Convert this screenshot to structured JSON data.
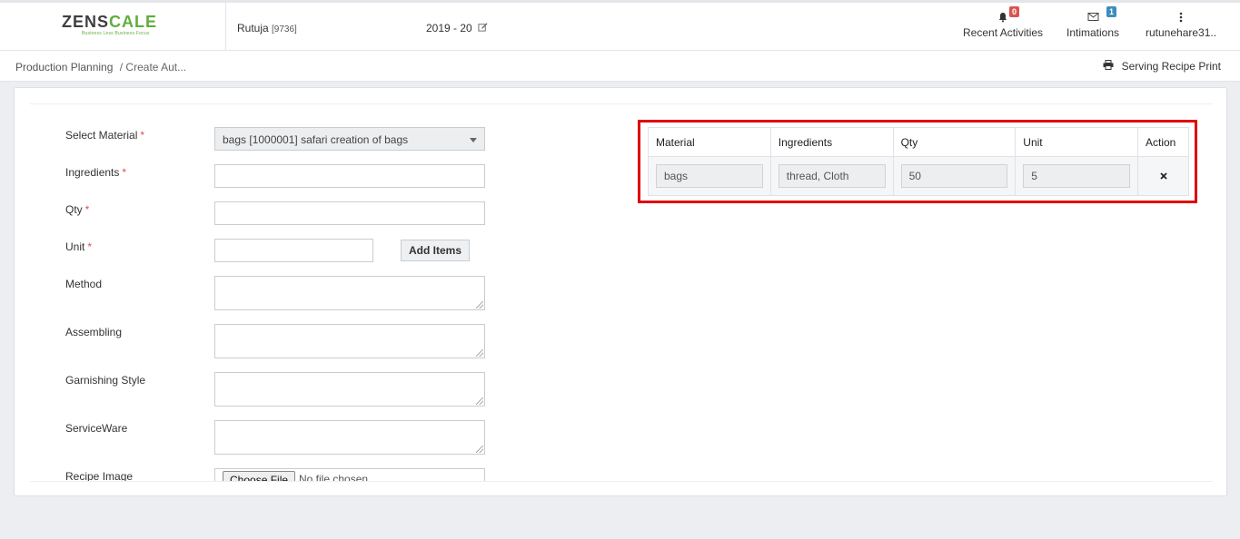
{
  "header": {
    "logo_main": "ZENSCALE",
    "logo_tagline": "Business Less Business Focus",
    "user_name": "Rutuja",
    "user_id": "[9736]",
    "year": "2019 - 20",
    "nav": [
      {
        "label": "Recent Activities",
        "badge": "0",
        "icon": "bell-icon"
      },
      {
        "label": "Intimations",
        "badge": "1",
        "icon": "envelope-icon"
      },
      {
        "label": "rutunehare31..",
        "icon": "vertical-dots-icon"
      }
    ]
  },
  "subbar": {
    "breadcrumb_root": "Production Planning",
    "breadcrumb_current": "/ Create Aut...",
    "print_label": "Serving Recipe Print"
  },
  "form": {
    "material_label": "Select Material",
    "material_value": "bags [1000001] safari creation of bags",
    "ingredients_label": "Ingredients",
    "qty_label": "Qty",
    "unit_label": "Unit",
    "add_items_label": "Add Items",
    "method_label": "Method",
    "assembling_label": "Assembling",
    "garnishing_label": "Garnishing Style",
    "serviceware_label": "ServiceWare",
    "recipe_image_label": "Recipe Image",
    "choose_file_label": "Choose File",
    "no_file_label": "No file chosen",
    "required_mark": "*"
  },
  "table": {
    "headers": [
      "Material",
      "Ingredients",
      "Qty",
      "Unit",
      "Action"
    ],
    "rows": [
      {
        "material": "bags",
        "ingredients": "thread, Cloth",
        "qty": "50",
        "unit": "5"
      }
    ]
  },
  "colors": {
    "highlight_border": "#e00000",
    "required": "#d9534f",
    "logo_green": "#5fae3e"
  }
}
